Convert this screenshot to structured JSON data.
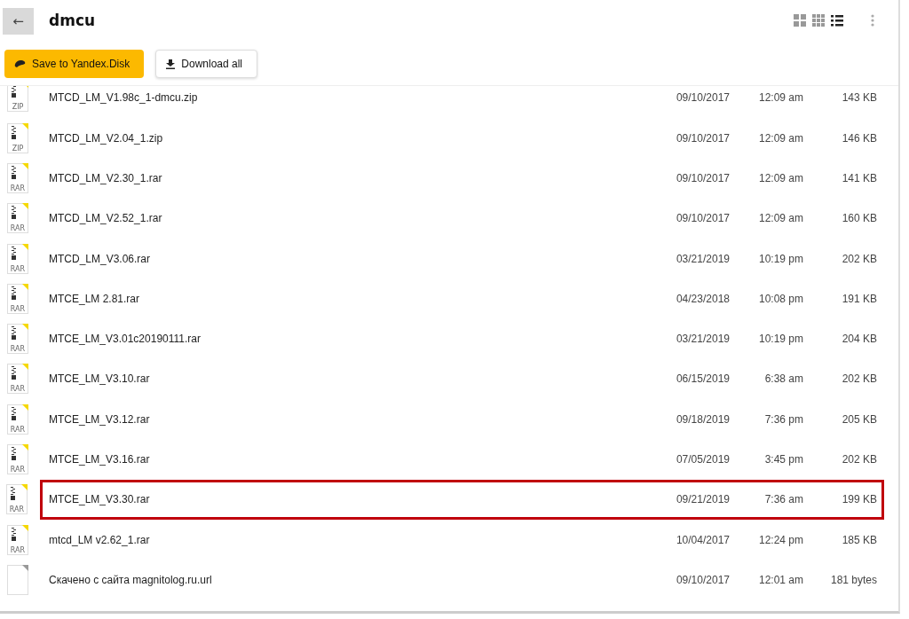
{
  "folder": {
    "back_icon": "←",
    "title": "dmcu"
  },
  "views": [
    {
      "kind": "large",
      "selected": false
    },
    {
      "kind": "small",
      "selected": false
    },
    {
      "kind": "list",
      "selected": true
    }
  ],
  "actions": [
    {
      "kind": "primary",
      "label": "Save to Yandex.Disk"
    },
    {
      "kind": "secondary",
      "label": "Download all"
    }
  ],
  "files": [
    {
      "kind": "archive",
      "type_label": "ZIP",
      "name": "MTCD_LM_V1.98c_1-dmcu.zip",
      "date": "09/10/2017",
      "time": "12:09 am",
      "size": "143 KB",
      "highlighted": false
    },
    {
      "kind": "archive",
      "type_label": "ZIP",
      "name": "MTCD_LM_V2.04_1.zip",
      "date": "09/10/2017",
      "time": "12:09 am",
      "size": "146 KB",
      "highlighted": false
    },
    {
      "kind": "archive",
      "type_label": "RAR",
      "name": "MTCD_LM_V2.30_1.rar",
      "date": "09/10/2017",
      "time": "12:09 am",
      "size": "141 KB",
      "highlighted": false
    },
    {
      "kind": "archive",
      "type_label": "RAR",
      "name": "MTCD_LM_V2.52_1.rar",
      "date": "09/10/2017",
      "time": "12:09 am",
      "size": "160 KB",
      "highlighted": false
    },
    {
      "kind": "archive",
      "type_label": "RAR",
      "name": "MTCD_LM_V3.06.rar",
      "date": "03/21/2019",
      "time": "10:19 pm",
      "size": "202 KB",
      "highlighted": false
    },
    {
      "kind": "archive",
      "type_label": "RAR",
      "name": "MTCE_LM 2.81.rar",
      "date": "04/23/2018",
      "time": "10:08 pm",
      "size": "191 KB",
      "highlighted": false
    },
    {
      "kind": "archive",
      "type_label": "RAR",
      "name": "MTCE_LM_V3.01c20190111.rar",
      "date": "03/21/2019",
      "time": "10:19 pm",
      "size": "204 KB",
      "highlighted": false
    },
    {
      "kind": "archive",
      "type_label": "RAR",
      "name": "MTCE_LM_V3.10.rar",
      "date": "06/15/2019",
      "time": "6:38 am",
      "size": "202 KB",
      "highlighted": false
    },
    {
      "kind": "archive",
      "type_label": "RAR",
      "name": "MTCE_LM_V3.12.rar",
      "date": "09/18/2019",
      "time": "7:36 pm",
      "size": "205 KB",
      "highlighted": false
    },
    {
      "kind": "archive",
      "type_label": "RAR",
      "name": "MTCE_LM_V3.16.rar",
      "date": "07/05/2019",
      "time": "3:45 pm",
      "size": "202 KB",
      "highlighted": false
    },
    {
      "kind": "archive",
      "type_label": "RAR",
      "name": "MTCE_LM_V3.30.rar",
      "date": "09/21/2019",
      "time": "7:36 am",
      "size": "199 KB",
      "highlighted": true
    },
    {
      "kind": "archive",
      "type_label": "RAR",
      "name": "mtcd_LM v2.62_1.rar",
      "date": "10/04/2017",
      "time": "12:24 pm",
      "size": "185 KB",
      "highlighted": false
    },
    {
      "kind": "document",
      "name": "Скачено с сайта magnitolog.ru.url",
      "date": "09/10/2017",
      "time": "12:01 am",
      "size": "181 bytes",
      "highlighted": false
    }
  ]
}
